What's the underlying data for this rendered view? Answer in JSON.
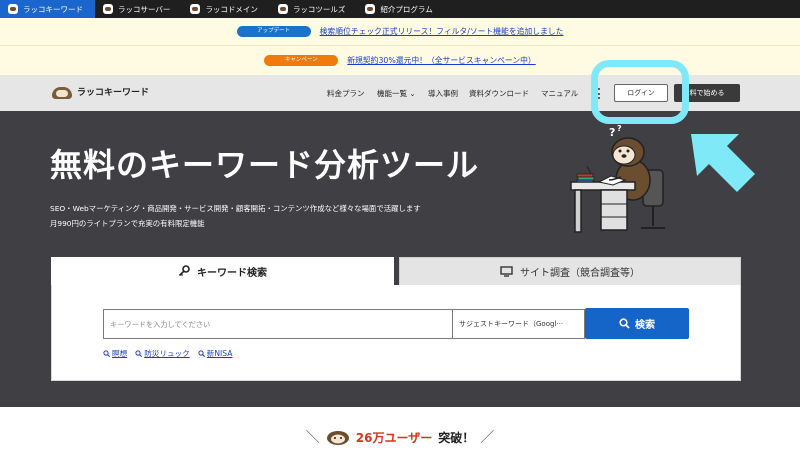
{
  "topbar": {
    "items": [
      {
        "label": "ラッコキーワード",
        "active": true,
        "icon": "otter-icon"
      },
      {
        "label": "ラッコサーバー",
        "active": false,
        "icon": "otter-icon"
      },
      {
        "label": "ラッコドメイン",
        "active": false,
        "icon": "otter-icon"
      },
      {
        "label": "ラッコツールズ",
        "active": false,
        "icon": "otter-icon"
      },
      {
        "label": "紹介プログラム",
        "active": false,
        "icon": "otter-icon"
      }
    ]
  },
  "notices": [
    {
      "badge": "アップデート",
      "text": "検索順位チェック正式リリース！フィルタ/ソート機能を追加しました",
      "badge_color": "#1a73c8"
    },
    {
      "badge": "キャンペーン",
      "text": "新規契約30%還元中！（全サービスキャンペーン中）",
      "badge_color": "#f07a0c"
    }
  ],
  "header": {
    "logo_text": "ラッコキーワード",
    "nav": [
      {
        "label": "料金プラン"
      },
      {
        "label": "機能一覧 ⌄"
      },
      {
        "label": "導入事例"
      },
      {
        "label": "資料ダウンロード"
      },
      {
        "label": "マニュアル"
      }
    ],
    "login_label": "ログイン",
    "start_label": "料で始める"
  },
  "hero": {
    "title": "無料のキーワード分析ツール",
    "subtitle_1": "SEO・Webマーケティング・商品開発・サービス開発・顧客開拓・コンテンツ作成など様々な場面で活躍します",
    "subtitle_2": "月990円のライトプランで充実の有料限定機能"
  },
  "search": {
    "tabs": [
      {
        "label": "キーワード検索",
        "icon": "key-icon",
        "active": true
      },
      {
        "label": "サイト調査（競合調査等）",
        "icon": "monitor-icon",
        "active": false
      }
    ],
    "input_placeholder": "キーワードを入力してください",
    "input_value": "",
    "suggest_value": "サジェストキーワード（Googl···",
    "button_label": "検索",
    "trends": [
      {
        "label": "瞑想"
      },
      {
        "label": "防災リュック"
      },
      {
        "label": "新NISA"
      }
    ]
  },
  "bottom": {
    "users_count": "26万ユーザー",
    "users_suffix": "突破！"
  },
  "colors": {
    "accent": "#1565c8",
    "hero_bg": "#3f3f44",
    "highlight": "#7fe9f7",
    "users_red": "#d8331e"
  }
}
